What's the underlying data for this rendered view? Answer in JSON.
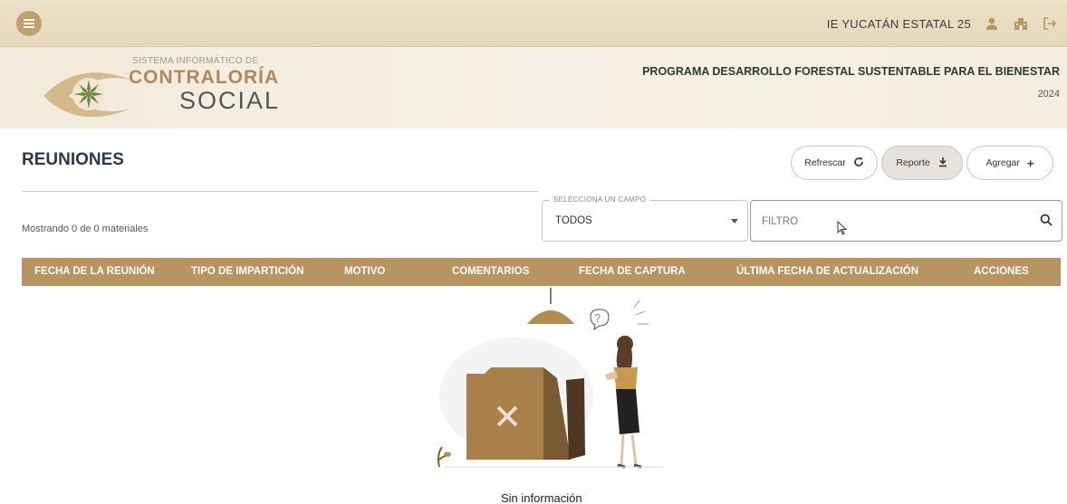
{
  "topbar": {
    "menu_icon": "hamburger-icon",
    "school_name": "IE YUCATÁN ESTATAL 25",
    "icons": [
      "user-icon",
      "school-building-icon",
      "logout-icon"
    ]
  },
  "header": {
    "logo_subtitle": "SISTEMA INFORMÁTICO DE",
    "logo_main": "CONTRALORÍA",
    "logo_social": "SOCIAL",
    "program_title": "PROGRAMA DESARROLLO FORESTAL SUSTENTABLE PARA EL BIENESTAR",
    "program_year": "2024"
  },
  "page": {
    "title": "REUNIONES",
    "count_text": "Mostrando 0 de 0 materiales"
  },
  "actions": {
    "refresh_label": "Refrescar",
    "report_label": "Reporte",
    "add_label": "Agregar",
    "refresh_icon": "refresh-icon",
    "report_icon": "download-icon",
    "add_icon": "plus-icon"
  },
  "filter": {
    "select_legend": "SELECCIONA UN CAMPO",
    "select_value": "TODOS",
    "placeholder": "FILTRO"
  },
  "table": {
    "columns": [
      "FECHA DE LA REUNIÓN",
      "TIPO DE IMPARTICIÓN",
      "MOTIVO",
      "COMENTARIOS",
      "FECHA DE CAPTURA",
      "ÚLTIMA FECHA DE ACTUALIZACIÓN",
      "ACCIONES"
    ]
  },
  "empty_state": {
    "text": "Sin información"
  },
  "colors": {
    "accent": "#b89461",
    "topbar": "#e6d8bc",
    "menu_button": "#bfa16e"
  }
}
